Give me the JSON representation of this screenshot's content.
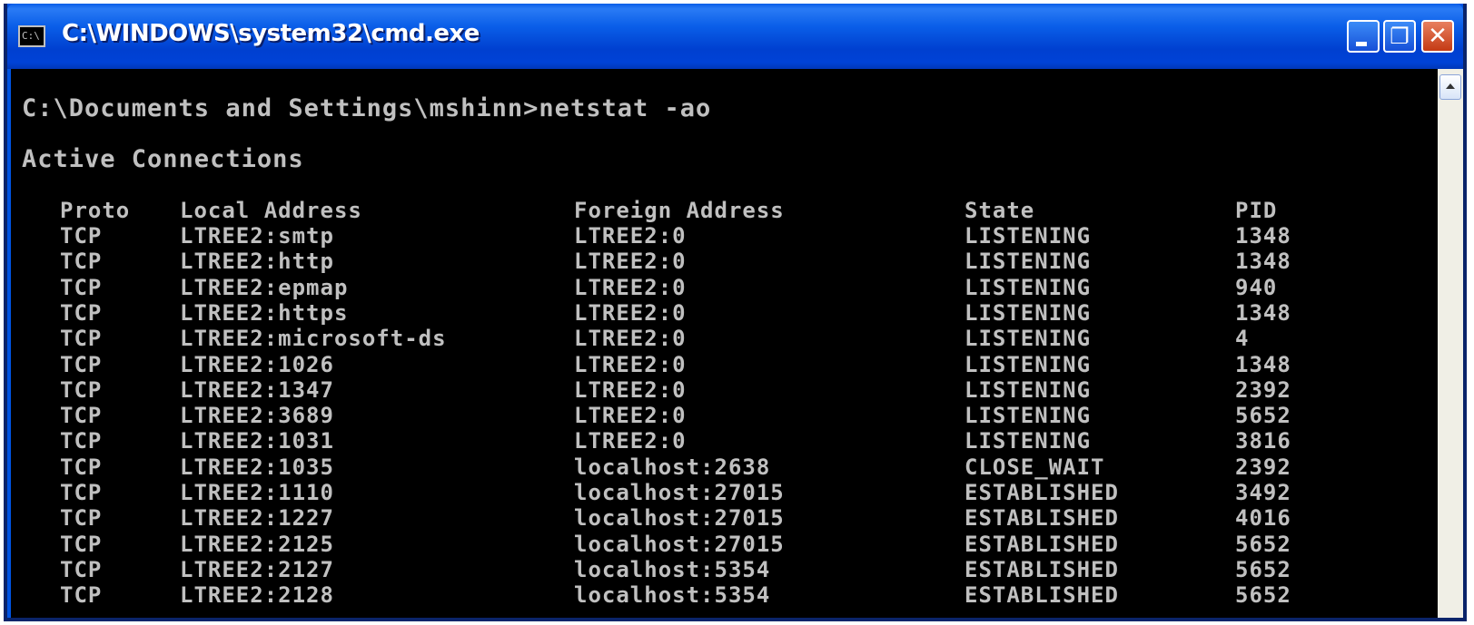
{
  "window": {
    "title": "C:\\WINDOWS\\system32\\cmd.exe",
    "icon_label": "C:\\",
    "icon": "cmd-icon",
    "buttons": {
      "minimize": "minimize-icon",
      "maximize": "maximize-icon",
      "close": "close-icon"
    },
    "colors": {
      "titlebar": "#0054e3",
      "console_bg": "#000000",
      "console_fg": "#c0c0c0"
    }
  },
  "console": {
    "command_line": "C:\\Documents and Settings\\mshinn>netstat -ao",
    "section_title": "Active Connections",
    "headers": {
      "proto": "Proto",
      "local": "Local Address",
      "foreign": "Foreign Address",
      "state": "State",
      "pid": "PID"
    },
    "rows": [
      {
        "proto": "TCP",
        "local": "LTREE2:smtp",
        "foreign": "LTREE2:0",
        "state": "LISTENING",
        "pid": "1348"
      },
      {
        "proto": "TCP",
        "local": "LTREE2:http",
        "foreign": "LTREE2:0",
        "state": "LISTENING",
        "pid": "1348"
      },
      {
        "proto": "TCP",
        "local": "LTREE2:epmap",
        "foreign": "LTREE2:0",
        "state": "LISTENING",
        "pid": "940"
      },
      {
        "proto": "TCP",
        "local": "LTREE2:https",
        "foreign": "LTREE2:0",
        "state": "LISTENING",
        "pid": "1348"
      },
      {
        "proto": "TCP",
        "local": "LTREE2:microsoft-ds",
        "foreign": "LTREE2:0",
        "state": "LISTENING",
        "pid": "4"
      },
      {
        "proto": "TCP",
        "local": "LTREE2:1026",
        "foreign": "LTREE2:0",
        "state": "LISTENING",
        "pid": "1348"
      },
      {
        "proto": "TCP",
        "local": "LTREE2:1347",
        "foreign": "LTREE2:0",
        "state": "LISTENING",
        "pid": "2392"
      },
      {
        "proto": "TCP",
        "local": "LTREE2:3689",
        "foreign": "LTREE2:0",
        "state": "LISTENING",
        "pid": "5652"
      },
      {
        "proto": "TCP",
        "local": "LTREE2:1031",
        "foreign": "LTREE2:0",
        "state": "LISTENING",
        "pid": "3816"
      },
      {
        "proto": "TCP",
        "local": "LTREE2:1035",
        "foreign": "localhost:2638",
        "state": "CLOSE_WAIT",
        "pid": "2392"
      },
      {
        "proto": "TCP",
        "local": "LTREE2:1110",
        "foreign": "localhost:27015",
        "state": "ESTABLISHED",
        "pid": "3492"
      },
      {
        "proto": "TCP",
        "local": "LTREE2:1227",
        "foreign": "localhost:27015",
        "state": "ESTABLISHED",
        "pid": "4016"
      },
      {
        "proto": "TCP",
        "local": "LTREE2:2125",
        "foreign": "localhost:27015",
        "state": "ESTABLISHED",
        "pid": "5652"
      },
      {
        "proto": "TCP",
        "local": "LTREE2:2127",
        "foreign": "localhost:5354",
        "state": "ESTABLISHED",
        "pid": "5652"
      },
      {
        "proto": "TCP",
        "local": "LTREE2:2128",
        "foreign": "localhost:5354",
        "state": "ESTABLISHED",
        "pid": "5652"
      }
    ]
  },
  "scrollbar": {
    "up_icon": "scroll-up-arrow-icon"
  }
}
